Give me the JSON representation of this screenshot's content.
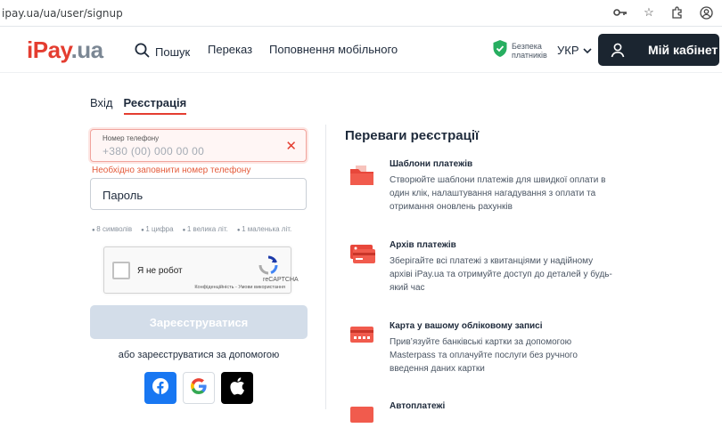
{
  "browser": {
    "url": "ipay.ua/ua/user/signup",
    "icons": [
      "key-icon",
      "star-icon",
      "extension-icon",
      "account-icon"
    ]
  },
  "header": {
    "logo": {
      "i": "i",
      "pay": "Pay",
      "ua": ".ua"
    },
    "search_label": "Пошук",
    "transfer_label": "Переказ",
    "mobile_label": "Поповнення мобільного",
    "security_line1": "Безпека",
    "security_line2": "платників",
    "language": "УКР",
    "cabinet_label": "Мій кабінет"
  },
  "auth": {
    "tab_login": "Вхід",
    "tab_register": "Реєстрація",
    "phone_label": "Номер телефону",
    "phone_placeholder": "+380 (00) 000 00 00",
    "phone_error": "Необхідно заповнити номер телефону",
    "password_placeholder": "Пароль",
    "password_rules": [
      "8 символів",
      "1 цифра",
      "1 велика літ.",
      "1 маленька літ."
    ],
    "captcha_label": "Я не робот",
    "captcha_brand": "reCAPTCHA",
    "captcha_links": "Конфіденційність - Умови використання",
    "register_button": "Зареєструватися",
    "or_text": "або зареєструватися за допомогою"
  },
  "benefits": {
    "title": "Переваги реєстрації",
    "items": [
      {
        "title": "Шаблони платежів",
        "text": "Створюйте шаблони платежів для швидкої оплати в один клік, налаштування нагадування з оплати та отримання оновлень рахунків"
      },
      {
        "title": "Архів платежів",
        "text": "Зберігайте всі платежі з квитанціями у надійному архіві iPay.ua та отримуйте доступ до деталей у будь-який час"
      },
      {
        "title": "Карта у вашому обліковому записі",
        "text": "Прив’язуйте банківські картки за допомогою Masterpass та оплачуйте послуги без ручного введення даних картки"
      },
      {
        "title": "Автоплатежі",
        "text": ""
      }
    ]
  },
  "colors": {
    "accent": "#e43d30",
    "dark": "#1b2530",
    "disabled": "#d3dde9"
  }
}
